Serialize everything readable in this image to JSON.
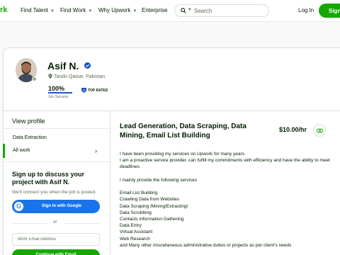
{
  "header": {
    "logo": "rk",
    "nav": [
      {
        "label": "Find Talent"
      },
      {
        "label": "Find Work"
      },
      {
        "label": "Why Upwork"
      },
      {
        "label": "Enterprise"
      }
    ],
    "search_placeholder": "Search",
    "login_label": "Log In",
    "signup_label": "Sign"
  },
  "profile": {
    "name": "Asif N.",
    "location": "Tando Qaisar, Pakistan",
    "job_success_value": "100%",
    "job_success_fraction": 1.0,
    "job_success_label": "Job Success",
    "top_rated_label": "TOP RATED"
  },
  "sidebar": {
    "view_profile": "View profile",
    "items": [
      {
        "label": "Data Extraction"
      },
      {
        "label": "All work"
      }
    ],
    "cta_title": "Sign up to discuss your project with Asif N.",
    "cta_subtitle": "We'll connect you when the job is posted.",
    "google_button": "Sign In with Google",
    "or_text": "or",
    "email_placeholder": "Work Email Address",
    "continue_button": "Continue with Email"
  },
  "main": {
    "headline": "Lead Generation, Data Scraping, Data Mining, Email List Building",
    "rate": "$10.00/hr",
    "description": [
      "I have been providing my services on Upwork for many years",
      "I am a proactive service provider, can fulfill my commitments with efficiency and have the ability to meet deadlines.",
      "",
      "I mainly provide the following services",
      "",
      "Email List Building",
      "Crawling Data from Websites",
      "Data Scraping /Mining/Extracting/",
      "Data Scrubbing",
      "Contacts Information Gathering",
      "Data Entry",
      "Virtual Assistant",
      "Web Research",
      "and Many other miscellaneous administrative duties or projects as per client's needs"
    ]
  },
  "colors": {
    "brand_green": "#14a800",
    "verified_blue": "#1f57c3",
    "google_blue": "#1a73e8"
  },
  "icons": [
    "search-icon",
    "chevron-down-icon",
    "verified-icon",
    "location-pin-icon",
    "top-rated-badge-icon",
    "chevron-right-icon",
    "google-icon",
    "link-icon"
  ]
}
